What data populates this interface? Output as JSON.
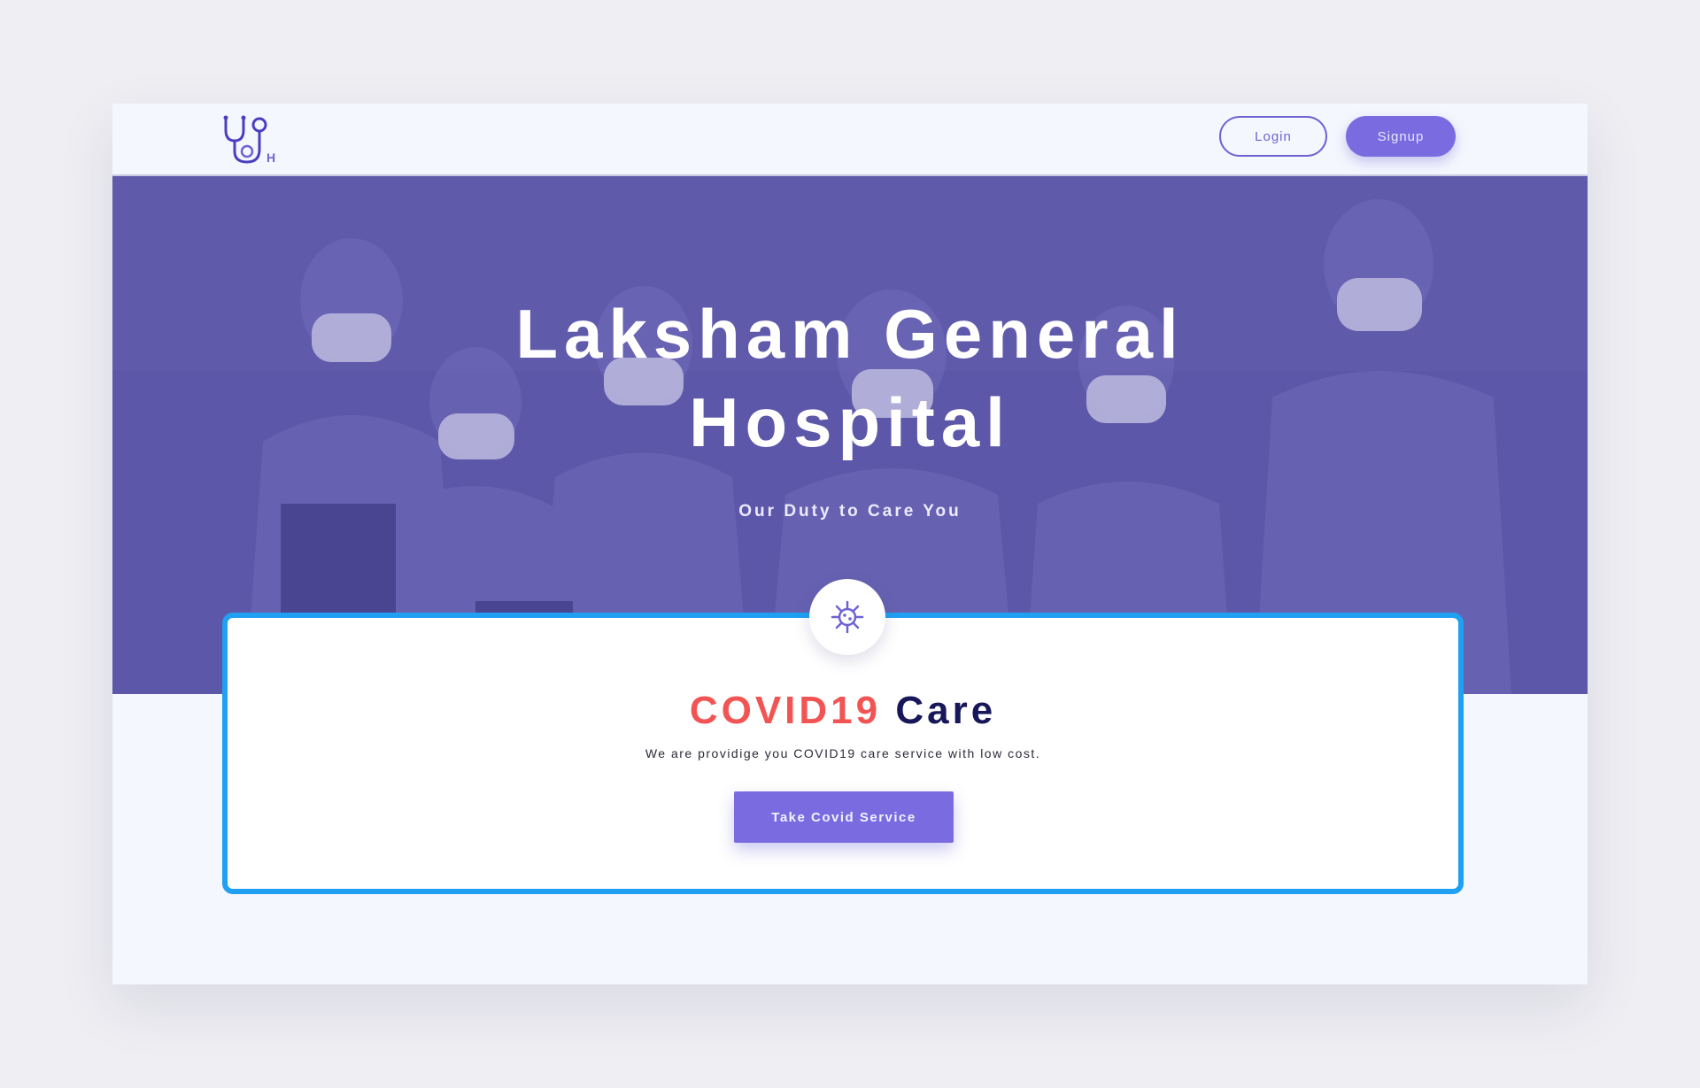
{
  "brand": {
    "logo_icon": "stethoscope-logo-icon",
    "logo_letter": "H",
    "accent_color": "#7a6ce0"
  },
  "nav": {
    "login_label": "Login",
    "signup_label": "Signup"
  },
  "hero": {
    "title": "Laksham General Hospital",
    "subtitle": "Our Duty to Care You",
    "overlay_color": "#5c57a5"
  },
  "covid_card": {
    "icon": "virus-icon",
    "title_highlight": "COVID19",
    "title_rest": "Care",
    "description": "We are providige you COVID19 care service with low cost.",
    "button_label": "Take Covid Service",
    "border_color": "#1fa0f2",
    "highlight_color": "#f25454"
  }
}
